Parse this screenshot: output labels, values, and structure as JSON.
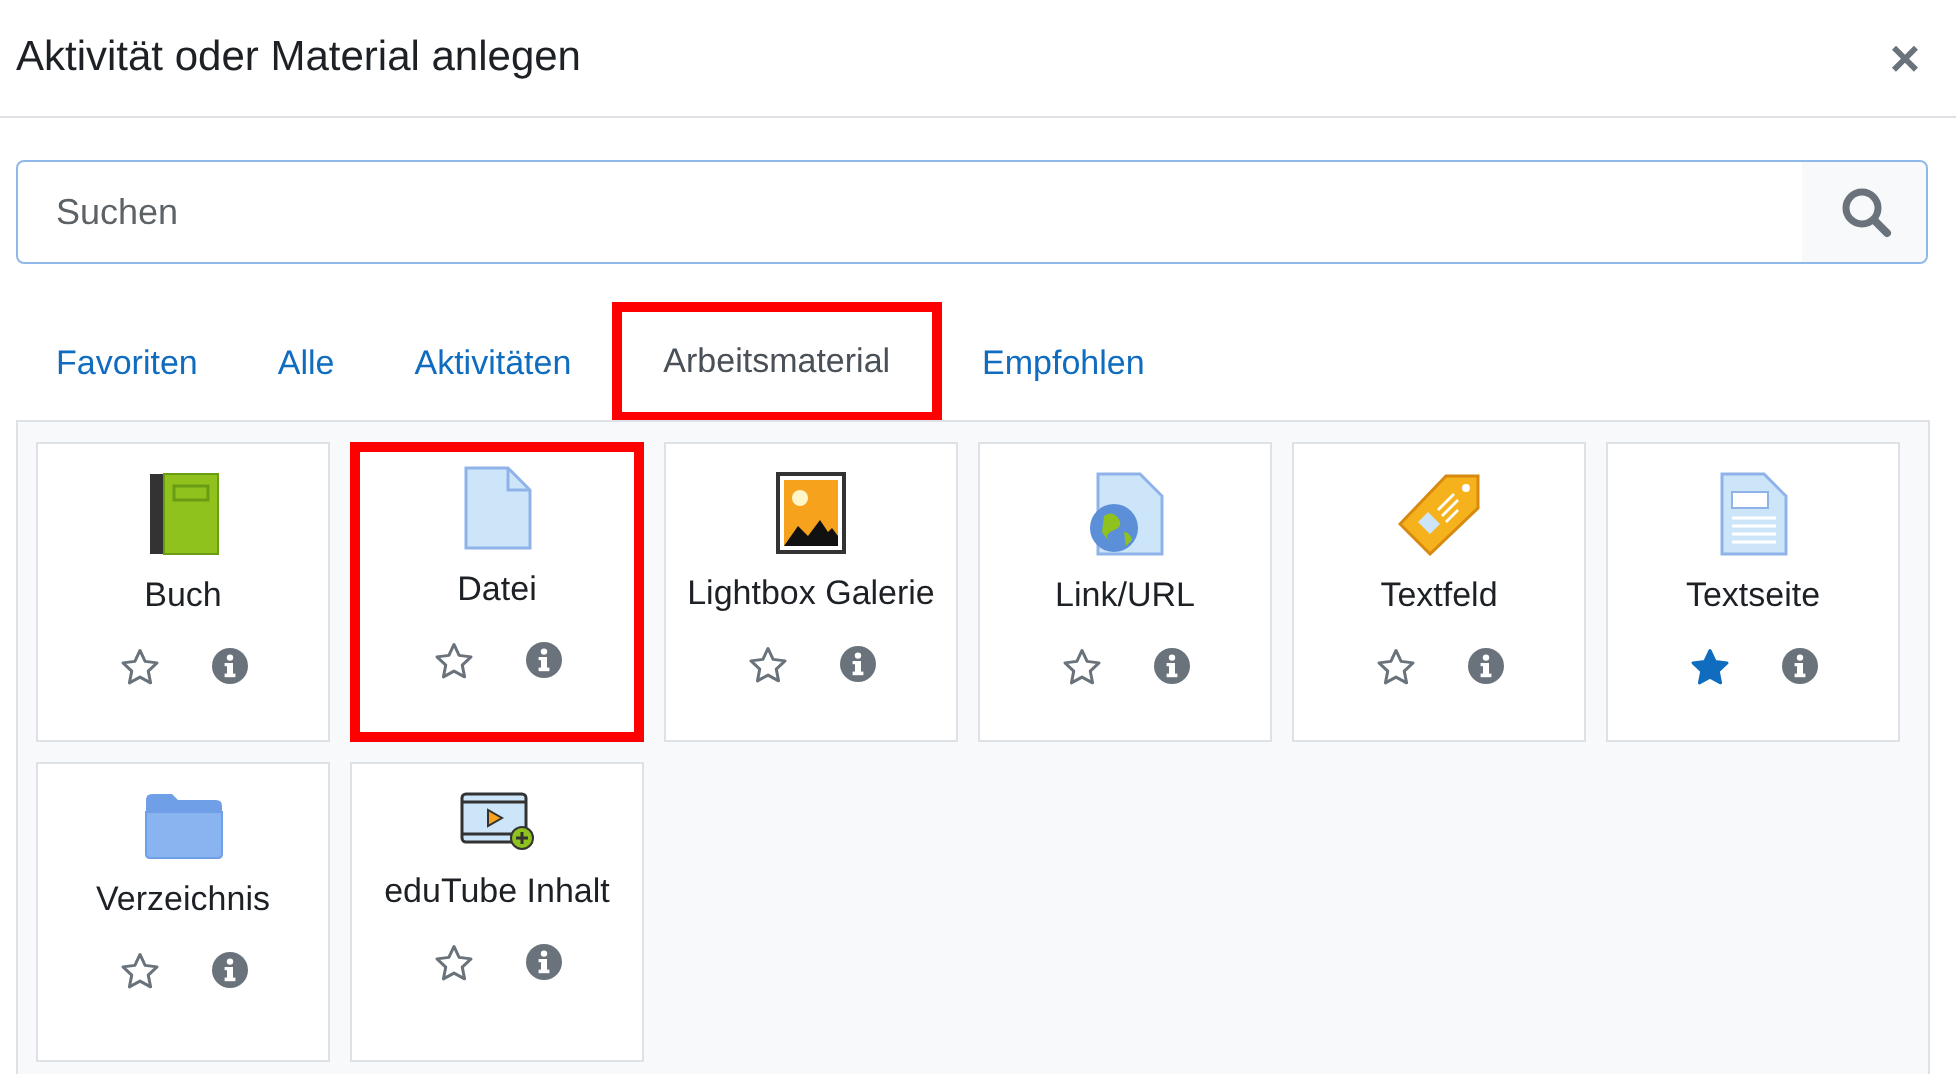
{
  "dialog": {
    "title": "Aktivität oder Material anlegen",
    "close": "×"
  },
  "search": {
    "placeholder": "Suchen"
  },
  "tabs": [
    {
      "label": "Favoriten",
      "selected": false,
      "highlighted": false
    },
    {
      "label": "Alle",
      "selected": false,
      "highlighted": false
    },
    {
      "label": "Aktivitäten",
      "selected": false,
      "highlighted": false
    },
    {
      "label": "Arbeitsmaterial",
      "selected": true,
      "highlighted": true
    },
    {
      "label": "Empfohlen",
      "selected": false,
      "highlighted": false
    }
  ],
  "items": [
    {
      "name": "Buch",
      "kind": "book",
      "starred": false,
      "highlighted": false
    },
    {
      "name": "Datei",
      "kind": "file",
      "starred": false,
      "highlighted": true
    },
    {
      "name": "Lightbox Galerie",
      "kind": "gallery",
      "starred": false,
      "highlighted": false
    },
    {
      "name": "Link/URL",
      "kind": "link",
      "starred": false,
      "highlighted": false
    },
    {
      "name": "Textfeld",
      "kind": "label",
      "starred": false,
      "highlighted": false
    },
    {
      "name": "Textseite",
      "kind": "page",
      "starred": true,
      "highlighted": false
    },
    {
      "name": "Verzeichnis",
      "kind": "folder",
      "starred": false,
      "highlighted": false
    },
    {
      "name": "eduTube Inhalt",
      "kind": "video",
      "starred": false,
      "highlighted": false
    }
  ]
}
